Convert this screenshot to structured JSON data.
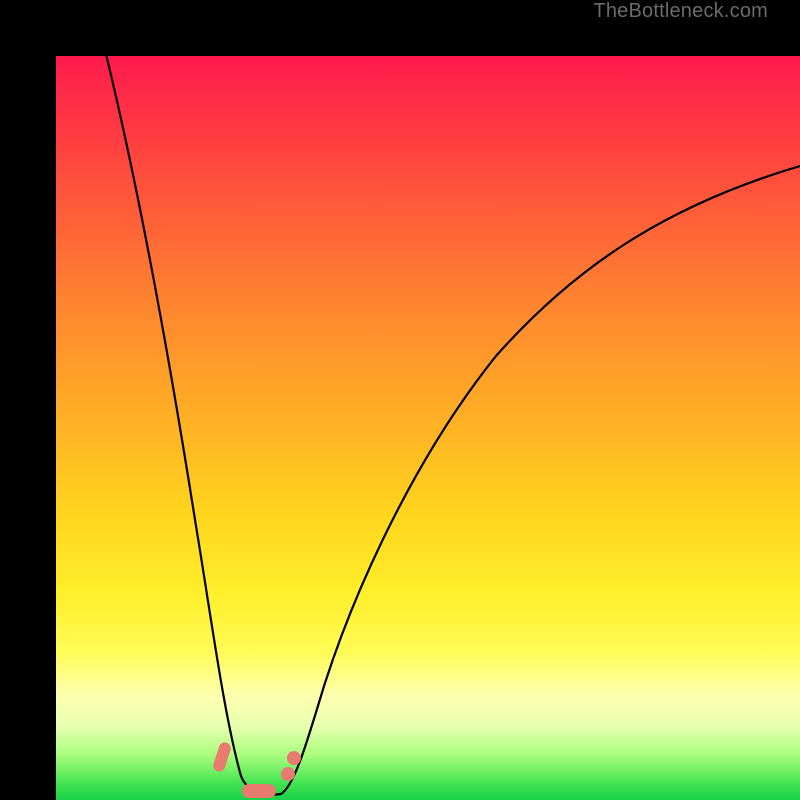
{
  "watermark": "TheBottleneck.com",
  "colors": {
    "frame": "#000000",
    "curve": "#000000",
    "marker": "#e87a6f",
    "gradient_top": "#ff1a4d",
    "gradient_bottom": "#18d148"
  },
  "chart_data": {
    "type": "line",
    "title": "",
    "xlabel": "",
    "ylabel": "",
    "xlim": [
      0,
      100
    ],
    "ylim": [
      0,
      100
    ],
    "note": "Axes are unlabeled in the source image; x and y are normalized 0–100. Curve represents bottleneck magnitude vs. a component ratio — minimum near x≈26.",
    "series": [
      {
        "name": "bottleneck-curve",
        "x": [
          0,
          4,
          8,
          12,
          16,
          20,
          22,
          24,
          26,
          28,
          30,
          34,
          40,
          48,
          58,
          70,
          85,
          100
        ],
        "values": [
          100,
          82,
          64,
          47,
          30,
          12,
          6,
          2,
          0,
          2,
          6,
          16,
          30,
          45,
          58,
          69,
          78,
          85
        ]
      }
    ],
    "markers": [
      {
        "x": 22.5,
        "y": 5,
        "shape": "pill-diag"
      },
      {
        "x": 27.5,
        "y": 0.8,
        "shape": "bar"
      },
      {
        "x": 31,
        "y": 4,
        "shape": "dot"
      },
      {
        "x": 31.5,
        "y": 6,
        "shape": "dot"
      }
    ]
  }
}
